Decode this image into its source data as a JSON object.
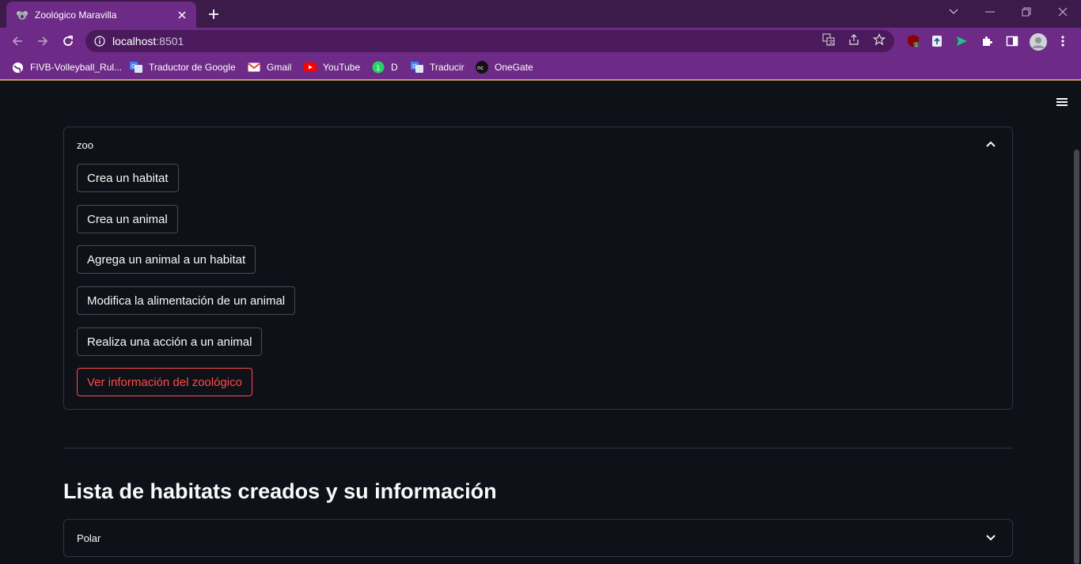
{
  "browser": {
    "tab_title": "Zoológico Maravilla",
    "url_host": "localhost",
    "url_port": ":8501",
    "bookmarks": [
      {
        "label": "FIVB-Volleyball_Rul...",
        "icon": "globe-icon"
      },
      {
        "label": "Traductor de Google",
        "icon": "translate-icon"
      },
      {
        "label": "Gmail",
        "icon": "gmail-icon"
      },
      {
        "label": "YouTube",
        "icon": "youtube-icon"
      },
      {
        "label": "D",
        "icon": "whatsapp-icon"
      },
      {
        "label": "Traducir",
        "icon": "translate-icon"
      },
      {
        "label": "OneGate",
        "icon": "onegate-icon"
      }
    ],
    "colors": {
      "tabstrip": "#3c1a4a",
      "toolbar": "#6d2a86"
    }
  },
  "app": {
    "zoo_expander": {
      "label": "zoo",
      "expanded": true,
      "buttons": [
        {
          "label": "Crea un habitat"
        },
        {
          "label": "Crea un animal"
        },
        {
          "label": "Agrega un animal a un habitat"
        },
        {
          "label": "Modifica la alimentación de un animal"
        },
        {
          "label": "Realiza una acción a un animal"
        },
        {
          "label": "Ver información del zoológico",
          "active": true
        }
      ]
    },
    "section_title": "Lista de habitats creados y su información",
    "habitat_expander": {
      "label": "Polar",
      "expanded": false
    },
    "colors": {
      "background": "#0e1117",
      "accent": "#ff4b4b",
      "border": "#31333f"
    }
  }
}
